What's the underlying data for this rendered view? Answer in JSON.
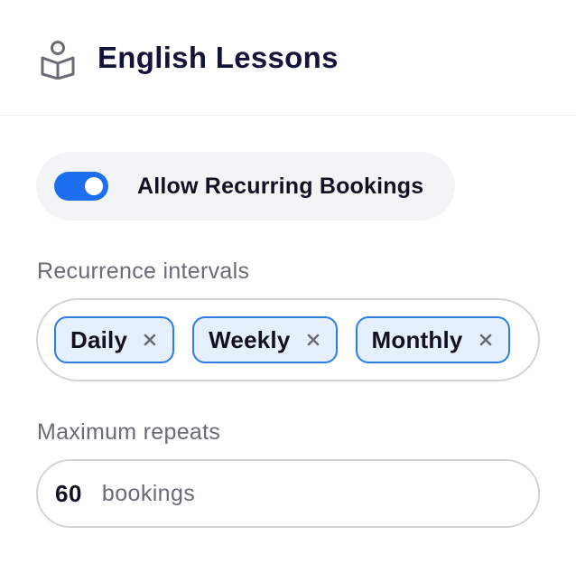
{
  "header": {
    "icon": "book-reader-icon",
    "title": "English Lessons"
  },
  "recurring": {
    "toggle_on": true,
    "label": "Allow Recurring Bookings"
  },
  "intervals": {
    "label": "Recurrence intervals",
    "tags": [
      {
        "label": "Daily"
      },
      {
        "label": "Weekly"
      },
      {
        "label": "Monthly"
      }
    ]
  },
  "repeats": {
    "label": "Maximum repeats",
    "value": "60",
    "unit": "bookings"
  },
  "colors": {
    "accent": "#1e6ff0",
    "tag_border": "#2b7de9",
    "tag_bg": "#e6f0fd",
    "title": "#14143a",
    "muted": "#6b6b75"
  }
}
